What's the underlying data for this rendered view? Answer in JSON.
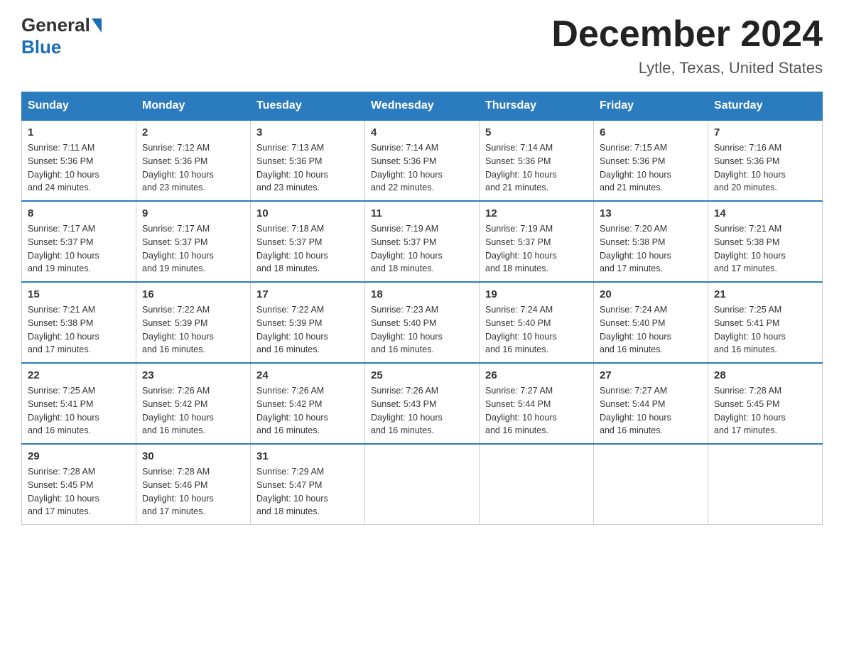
{
  "logo": {
    "general": "General",
    "blue": "Blue"
  },
  "title": "December 2024",
  "location": "Lytle, Texas, United States",
  "days_of_week": [
    "Sunday",
    "Monday",
    "Tuesday",
    "Wednesday",
    "Thursday",
    "Friday",
    "Saturday"
  ],
  "weeks": [
    [
      {
        "day": "1",
        "sunrise": "7:11 AM",
        "sunset": "5:36 PM",
        "daylight": "10 hours and 24 minutes."
      },
      {
        "day": "2",
        "sunrise": "7:12 AM",
        "sunset": "5:36 PM",
        "daylight": "10 hours and 23 minutes."
      },
      {
        "day": "3",
        "sunrise": "7:13 AM",
        "sunset": "5:36 PM",
        "daylight": "10 hours and 23 minutes."
      },
      {
        "day": "4",
        "sunrise": "7:14 AM",
        "sunset": "5:36 PM",
        "daylight": "10 hours and 22 minutes."
      },
      {
        "day": "5",
        "sunrise": "7:14 AM",
        "sunset": "5:36 PM",
        "daylight": "10 hours and 21 minutes."
      },
      {
        "day": "6",
        "sunrise": "7:15 AM",
        "sunset": "5:36 PM",
        "daylight": "10 hours and 21 minutes."
      },
      {
        "day": "7",
        "sunrise": "7:16 AM",
        "sunset": "5:36 PM",
        "daylight": "10 hours and 20 minutes."
      }
    ],
    [
      {
        "day": "8",
        "sunrise": "7:17 AM",
        "sunset": "5:37 PM",
        "daylight": "10 hours and 19 minutes."
      },
      {
        "day": "9",
        "sunrise": "7:17 AM",
        "sunset": "5:37 PM",
        "daylight": "10 hours and 19 minutes."
      },
      {
        "day": "10",
        "sunrise": "7:18 AM",
        "sunset": "5:37 PM",
        "daylight": "10 hours and 18 minutes."
      },
      {
        "day": "11",
        "sunrise": "7:19 AM",
        "sunset": "5:37 PM",
        "daylight": "10 hours and 18 minutes."
      },
      {
        "day": "12",
        "sunrise": "7:19 AM",
        "sunset": "5:37 PM",
        "daylight": "10 hours and 18 minutes."
      },
      {
        "day": "13",
        "sunrise": "7:20 AM",
        "sunset": "5:38 PM",
        "daylight": "10 hours and 17 minutes."
      },
      {
        "day": "14",
        "sunrise": "7:21 AM",
        "sunset": "5:38 PM",
        "daylight": "10 hours and 17 minutes."
      }
    ],
    [
      {
        "day": "15",
        "sunrise": "7:21 AM",
        "sunset": "5:38 PM",
        "daylight": "10 hours and 17 minutes."
      },
      {
        "day": "16",
        "sunrise": "7:22 AM",
        "sunset": "5:39 PM",
        "daylight": "10 hours and 16 minutes."
      },
      {
        "day": "17",
        "sunrise": "7:22 AM",
        "sunset": "5:39 PM",
        "daylight": "10 hours and 16 minutes."
      },
      {
        "day": "18",
        "sunrise": "7:23 AM",
        "sunset": "5:40 PM",
        "daylight": "10 hours and 16 minutes."
      },
      {
        "day": "19",
        "sunrise": "7:24 AM",
        "sunset": "5:40 PM",
        "daylight": "10 hours and 16 minutes."
      },
      {
        "day": "20",
        "sunrise": "7:24 AM",
        "sunset": "5:40 PM",
        "daylight": "10 hours and 16 minutes."
      },
      {
        "day": "21",
        "sunrise": "7:25 AM",
        "sunset": "5:41 PM",
        "daylight": "10 hours and 16 minutes."
      }
    ],
    [
      {
        "day": "22",
        "sunrise": "7:25 AM",
        "sunset": "5:41 PM",
        "daylight": "10 hours and 16 minutes."
      },
      {
        "day": "23",
        "sunrise": "7:26 AM",
        "sunset": "5:42 PM",
        "daylight": "10 hours and 16 minutes."
      },
      {
        "day": "24",
        "sunrise": "7:26 AM",
        "sunset": "5:42 PM",
        "daylight": "10 hours and 16 minutes."
      },
      {
        "day": "25",
        "sunrise": "7:26 AM",
        "sunset": "5:43 PM",
        "daylight": "10 hours and 16 minutes."
      },
      {
        "day": "26",
        "sunrise": "7:27 AM",
        "sunset": "5:44 PM",
        "daylight": "10 hours and 16 minutes."
      },
      {
        "day": "27",
        "sunrise": "7:27 AM",
        "sunset": "5:44 PM",
        "daylight": "10 hours and 16 minutes."
      },
      {
        "day": "28",
        "sunrise": "7:28 AM",
        "sunset": "5:45 PM",
        "daylight": "10 hours and 17 minutes."
      }
    ],
    [
      {
        "day": "29",
        "sunrise": "7:28 AM",
        "sunset": "5:45 PM",
        "daylight": "10 hours and 17 minutes."
      },
      {
        "day": "30",
        "sunrise": "7:28 AM",
        "sunset": "5:46 PM",
        "daylight": "10 hours and 17 minutes."
      },
      {
        "day": "31",
        "sunrise": "7:29 AM",
        "sunset": "5:47 PM",
        "daylight": "10 hours and 18 minutes."
      },
      null,
      null,
      null,
      null
    ]
  ],
  "labels": {
    "sunrise": "Sunrise:",
    "sunset": "Sunset:",
    "daylight": "Daylight:"
  }
}
